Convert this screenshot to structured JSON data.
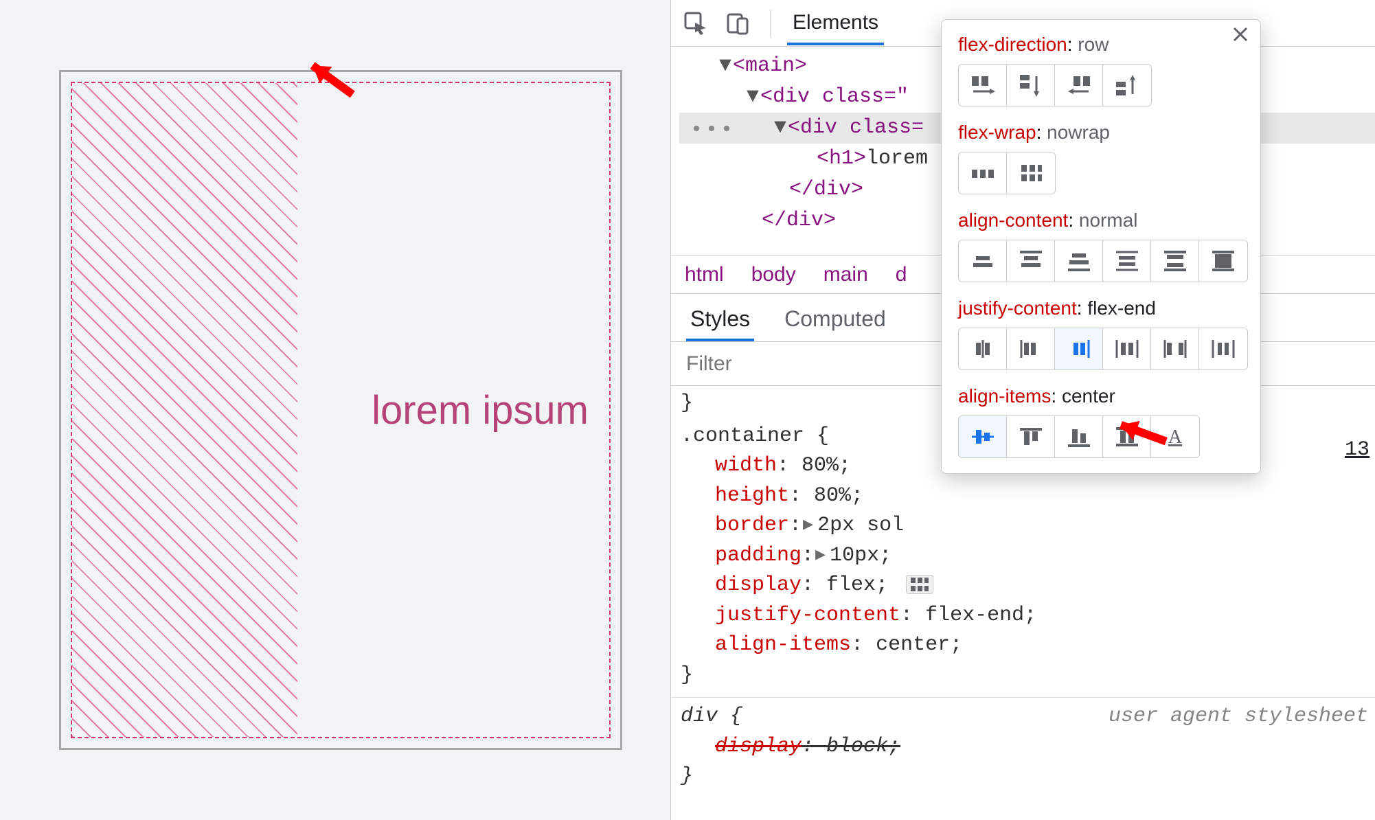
{
  "preview": {
    "heading": "lorem ipsum"
  },
  "devtoolsTabs": {
    "elements": "Elements"
  },
  "dom": {
    "main": "<main>",
    "div1": "<div class=\"",
    "div2": "<div class=",
    "h1_open": "<h1>",
    "h1_text": "lorem",
    "div_close1": "</div>",
    "div_close2": "</div>",
    "ellipsis": "•••"
  },
  "breadcrumbs": {
    "html": "html",
    "body": "body",
    "main": "main",
    "d": "d"
  },
  "stylesTabs": {
    "styles": "Styles",
    "computed": "Computed"
  },
  "filterPlaceholder": "Filter",
  "cssLink": "13",
  "css": {
    "selector": ".container {",
    "rules": [
      {
        "prop": "width",
        "colon": ": ",
        "val": "80%;"
      },
      {
        "prop": "height",
        "colon": ": ",
        "val": "80%;"
      },
      {
        "prop": "border",
        "colon": ":",
        "tri": "▸",
        "val": "2px sol"
      },
      {
        "prop": "padding",
        "colon": ":",
        "tri": "▸",
        "val": "10px;"
      },
      {
        "prop": "display",
        "colon": ": ",
        "val": "flex;",
        "flexbadge": true
      },
      {
        "prop": "justify-content",
        "colon": ": ",
        "val": "flex-end;"
      },
      {
        "prop": "align-items",
        "colon": ": ",
        "val": "center;"
      }
    ],
    "close": "}",
    "ua_selector": "div {",
    "ua_note": "user agent stylesheet",
    "ua_rule_prop": "display",
    "ua_rule_val": "block;",
    "ua_close": "}"
  },
  "popover": {
    "flexDirection": {
      "key": "flex-direction",
      "val": "row"
    },
    "flexWrap": {
      "key": "flex-wrap",
      "val": "nowrap"
    },
    "alignContent": {
      "key": "align-content",
      "val": "normal"
    },
    "justifyContent": {
      "key": "justify-content",
      "val": "flex-end"
    },
    "alignItems": {
      "key": "align-items",
      "val": "center"
    }
  }
}
